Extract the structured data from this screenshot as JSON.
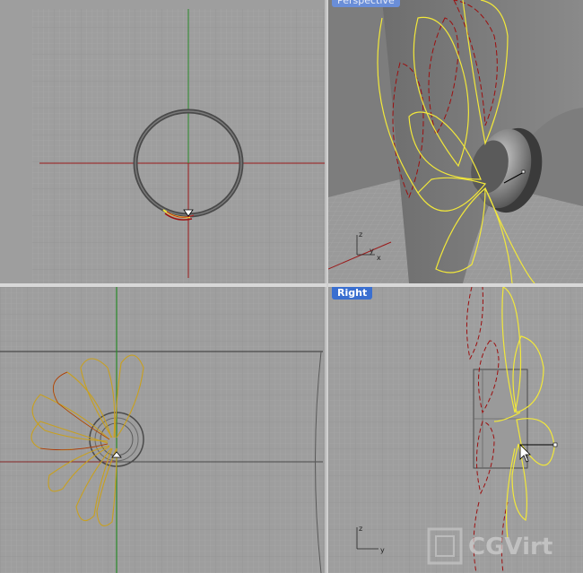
{
  "viewports": {
    "top": {
      "title": ""
    },
    "perspective": {
      "title": "Perspective"
    },
    "front": {
      "title": ""
    },
    "right": {
      "title": "Right"
    }
  },
  "axis_labels": {
    "perspective": {
      "z": "z",
      "y": "y",
      "x": "x"
    },
    "right": {
      "z": "z",
      "y": "y"
    }
  },
  "colors": {
    "viewport_bg": "#9e9e9e",
    "grid_minor": "#a8a8a8",
    "grid_major": "#8e8e8e",
    "axis_x": "#9a1a1a",
    "axis_y": "#2a8a2a",
    "curve_yellow": "#f2e83a",
    "curve_red": "#9c1010",
    "highlight": "#3a6fd0"
  },
  "watermark": {
    "text": "CGVirt"
  }
}
